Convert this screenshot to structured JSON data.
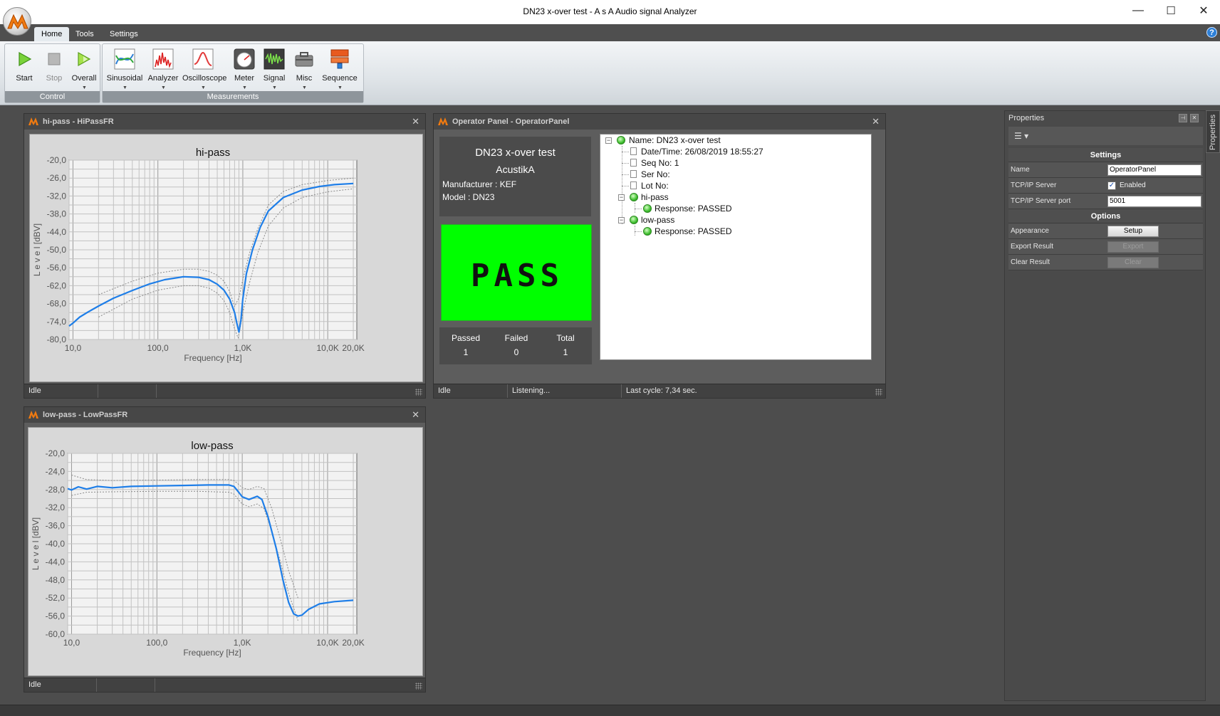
{
  "window": {
    "title": "DN23 x-over test - A s A  Audio signal Analyzer",
    "minimize": "—",
    "maximize": "☐",
    "close": "✕"
  },
  "tabs": [
    {
      "label": "Home",
      "active": true
    },
    {
      "label": "Tools"
    },
    {
      "label": "Settings"
    }
  ],
  "help": "?",
  "ribbon": {
    "control": {
      "label": "Control",
      "buttons": [
        {
          "label": "Start"
        },
        {
          "label": "Stop",
          "disabled": true
        },
        {
          "label": "Overall"
        }
      ]
    },
    "measurements": {
      "label": "Measurements",
      "buttons": [
        {
          "label": "Sinusoidal"
        },
        {
          "label": "Analyzer"
        },
        {
          "label": "Oscilloscope"
        },
        {
          "label": "Meter"
        },
        {
          "label": "Signal"
        },
        {
          "label": "Misc"
        },
        {
          "label": "Sequence"
        }
      ]
    }
  },
  "hipass_panel": {
    "title": "hi-pass - HiPassFR",
    "status": [
      "Idle",
      "",
      ""
    ],
    "chart_data": {
      "type": "line",
      "title": "hi-pass",
      "xlabel": "Frequency [Hz]",
      "ylabel": "L e v e l  [dBV]",
      "x_scale": "log",
      "xlim": [
        9,
        22000
      ],
      "ylim": [
        -80,
        -20
      ],
      "x_ticks": [
        10,
        100,
        1000,
        10000,
        20000
      ],
      "x_tick_labels": [
        "10,0",
        "100,0",
        "1,0K",
        "10,0K",
        "20,0K"
      ],
      "y_ticks": [
        -20,
        -26,
        -32,
        -38,
        -44,
        -50,
        -56,
        -62,
        -68,
        -74,
        -80
      ],
      "y_tick_labels": [
        "-20,0",
        "-26,0",
        "-32,0",
        "-38,0",
        "-44,0",
        "-50,0",
        "-56,0",
        "-62,0",
        "-68,0",
        "-74,0",
        "-80,0"
      ],
      "grid": true,
      "series": [
        {
          "role": "response",
          "color": "#1e7ee8",
          "x": [
            9,
            10,
            12,
            15,
            20,
            30,
            50,
            80,
            120,
            200,
            300,
            400,
            500,
            600,
            700,
            800,
            850,
            900,
            950,
            1000,
            1100,
            1300,
            1600,
            2000,
            3000,
            5000,
            8000,
            12000,
            20000
          ],
          "y": [
            -75.5,
            -74.5,
            -72.5,
            -70.8,
            -68.8,
            -66.2,
            -63.6,
            -61.4,
            -60.0,
            -59.0,
            -59.2,
            -60.0,
            -61.5,
            -63.5,
            -66.5,
            -71.0,
            -74.5,
            -77.5,
            -73.5,
            -66.5,
            -58.0,
            -50.0,
            -42.5,
            -37.0,
            -32.5,
            -30.0,
            -28.8,
            -28.2,
            -27.8
          ]
        },
        {
          "role": "upper-limit",
          "color": "#8a8a8a",
          "x": [
            20,
            50,
            100,
            200,
            300,
            400,
            500,
            600,
            700,
            800,
            900,
            1000,
            1200,
            1500,
            2000,
            3000,
            5000,
            10000,
            20000
          ],
          "y": [
            -65.0,
            -60.5,
            -57.8,
            -56.5,
            -56.5,
            -57.2,
            -58.5,
            -60.5,
            -64.0,
            -69.0,
            -66.0,
            -60.0,
            -51.0,
            -43.0,
            -35.0,
            -30.5,
            -28.2,
            -26.8,
            -26.0
          ]
        },
        {
          "role": "lower-limit",
          "color": "#8a8a8a",
          "x": [
            20,
            50,
            100,
            200,
            300,
            400,
            500,
            600,
            700,
            800,
            880,
            920,
            1000,
            1200,
            1500,
            2000,
            3000,
            5000,
            10000,
            20000
          ],
          "y": [
            -72.5,
            -66.5,
            -63.5,
            -62.0,
            -62.0,
            -62.8,
            -64.5,
            -67.0,
            -71.0,
            -76.5,
            -79.5,
            -77.0,
            -71.0,
            -61.0,
            -51.0,
            -42.0,
            -36.0,
            -32.5,
            -30.6,
            -29.6
          ]
        }
      ]
    }
  },
  "lowpass_panel": {
    "title": "low-pass - LowPassFR",
    "status": [
      "Idle",
      "",
      ""
    ],
    "chart_data": {
      "type": "line",
      "title": "low-pass",
      "xlabel": "Frequency [Hz]",
      "ylabel": "L e v e l  [dBV]",
      "x_scale": "log",
      "xlim": [
        9,
        22000
      ],
      "ylim": [
        -60,
        -20
      ],
      "x_ticks": [
        10,
        100,
        1000,
        10000,
        20000
      ],
      "x_tick_labels": [
        "10,0",
        "100,0",
        "1,0K",
        "10,0K",
        "20,0K"
      ],
      "y_ticks": [
        -20,
        -24,
        -28,
        -32,
        -36,
        -40,
        -44,
        -48,
        -52,
        -56,
        -60
      ],
      "y_tick_labels": [
        "-20,0",
        "-24,0",
        "-28,0",
        "-32,0",
        "-36,0",
        "-40,0",
        "-44,0",
        "-48,0",
        "-52,0",
        "-56,0",
        "-60,0"
      ],
      "grid": true,
      "series": [
        {
          "role": "response",
          "color": "#1e7ee8",
          "x": [
            9,
            10,
            12,
            15,
            20,
            30,
            50,
            100,
            200,
            400,
            600,
            700,
            800,
            900,
            1000,
            1200,
            1500,
            1700,
            2000,
            2500,
            3000,
            3500,
            4000,
            4500,
            5000,
            6000,
            8000,
            12000,
            20000
          ],
          "y": [
            -27.8,
            -28.1,
            -27.4,
            -27.9,
            -27.3,
            -27.6,
            -27.3,
            -27.2,
            -27.1,
            -27.0,
            -27.0,
            -27.0,
            -27.3,
            -28.5,
            -29.6,
            -30.2,
            -29.5,
            -30.2,
            -34.0,
            -41.0,
            -48.0,
            -53.0,
            -55.5,
            -56.0,
            -55.8,
            -54.5,
            -53.3,
            -52.8,
            -52.5
          ]
        },
        {
          "role": "upper-limit",
          "color": "#8a8a8a",
          "x": [
            10,
            15,
            30,
            100,
            300,
            700,
            800,
            900,
            1000,
            1200,
            1500,
            1800,
            2200,
            2800,
            3500,
            4500
          ],
          "y": [
            -24.8,
            -25.8,
            -26.0,
            -25.9,
            -25.8,
            -25.8,
            -26.0,
            -26.8,
            -27.6,
            -28.0,
            -27.3,
            -27.8,
            -32.0,
            -39.0,
            -46.0,
            -52.0
          ]
        },
        {
          "role": "lower-limit",
          "color": "#8a8a8a",
          "x": [
            10,
            15,
            30,
            100,
            300,
            700,
            800,
            900,
            1000,
            1200,
            1500,
            1800,
            2200,
            2800,
            3500,
            4500
          ],
          "y": [
            -29.3,
            -28.6,
            -28.5,
            -28.4,
            -28.4,
            -28.6,
            -29.0,
            -30.2,
            -31.2,
            -31.8,
            -31.2,
            -32.2,
            -37.0,
            -44.0,
            -51.0,
            -57.0
          ]
        }
      ]
    }
  },
  "operator_panel": {
    "title": "Operator Panel - OperatorPanel",
    "test_name": "DN23 x-over test",
    "manufacturer_brand": "AcustikA",
    "manufacturer_line": "Manufacturer : KEF",
    "model_line": "Model : DN23",
    "result": "PASS",
    "result_color": "#00ff00",
    "counts": {
      "passed_label": "Passed",
      "failed_label": "Failed",
      "total_label": "Total",
      "passed": "1",
      "failed": "0",
      "total": "1"
    },
    "tree": {
      "name": "Name: DN23 x-over test",
      "datetime": "Date/Time: 26/08/2019 18:55:27",
      "seq": "Seq No: 1",
      "ser": "Ser No:",
      "lot": "Lot No:",
      "hipass": "hi-pass",
      "hipass_result": "Response: PASSED",
      "lowpass": "low-pass",
      "lowpass_result": "Response: PASSED"
    },
    "status": [
      "Idle",
      "Listening...",
      "Last cycle: 7,34 sec."
    ]
  },
  "properties": {
    "title": "Properties",
    "side_tab": "Properties",
    "settings_header": "Settings",
    "options_header": "Options",
    "name_label": "Name",
    "name_value": "OperatorPanel",
    "tcp_label": "TCP/IP Server",
    "tcp_enabled_label": "Enabled",
    "tcp_enabled": true,
    "port_label": "TCP/IP Server port",
    "port_value": "5001",
    "appearance_label": "Appearance",
    "appearance_button": "Setup",
    "export_label": "Export Result",
    "export_button": "Export",
    "clear_label": "Clear Result",
    "clear_button": "Clear"
  }
}
